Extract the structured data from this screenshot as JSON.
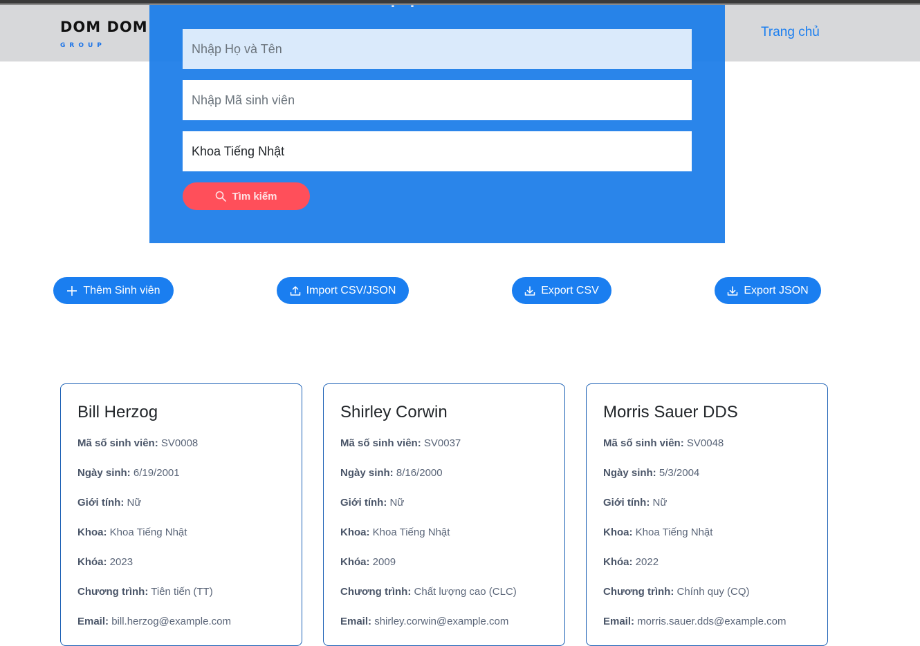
{
  "navbar": {
    "brand_name": "DOM DOM",
    "brand_sub": "GROUP",
    "home_link": "Trang chủ"
  },
  "search": {
    "title": "Bộ lọc tìm kiếm",
    "name_placeholder": "Nhập Họ và Tên",
    "id_placeholder": "Nhập Mã sinh viên",
    "faculty_value": "Khoa Tiếng Nhật",
    "search_button": "Tìm kiếm"
  },
  "actions": {
    "add": "Thêm Sinh viên",
    "import": "Import CSV/JSON",
    "export_csv": "Export CSV",
    "export_json": "Export JSON"
  },
  "labels": {
    "student_id": "Mã số sinh viên:",
    "dob": "Ngày sinh:",
    "gender": "Giới tính:",
    "faculty": "Khoa:",
    "cohort": "Khóa:",
    "program": "Chương trình:",
    "email": "Email:"
  },
  "students": [
    {
      "name": "Bill Herzog",
      "student_id": "SV0008",
      "dob": "6/19/2001",
      "gender": "Nữ",
      "faculty": "Khoa Tiếng Nhật",
      "cohort": "2023",
      "program": "Tiên tiến (TT)",
      "email": "bill.herzog@example.com"
    },
    {
      "name": "Shirley Corwin",
      "student_id": "SV0037",
      "dob": "8/16/2000",
      "gender": "Nữ",
      "faculty": "Khoa Tiếng Nhật",
      "cohort": "2009",
      "program": "Chất lượng cao (CLC)",
      "email": "shirley.corwin@example.com"
    },
    {
      "name": "Morris Sauer DDS",
      "student_id": "SV0048",
      "dob": "5/3/2004",
      "gender": "Nữ",
      "faculty": "Khoa Tiếng Nhật",
      "cohort": "2022",
      "program": "Chính quy (CQ)",
      "email": "morris.sauer.dds@example.com"
    }
  ]
}
